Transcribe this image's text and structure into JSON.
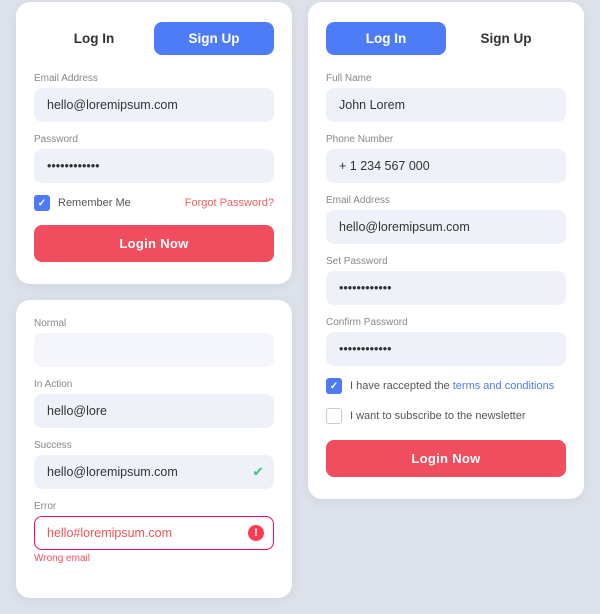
{
  "left_card": {
    "tabs": [
      {
        "label": "Log In",
        "active": false
      },
      {
        "label": "Sign Up",
        "active": true
      }
    ],
    "fields": [
      {
        "label": "Email Address",
        "value": "hello@loremipsum.com",
        "type": "text"
      },
      {
        "label": "Password",
        "value": "············",
        "type": "password"
      }
    ],
    "remember_me": "Remember Me",
    "forgot_password": "Forgot Password?",
    "login_button": "Login Now"
  },
  "states_card": {
    "states": [
      {
        "label": "Normal",
        "value": "",
        "state": "normal"
      },
      {
        "label": "In Action",
        "value": "hello@lore",
        "state": "in-action"
      },
      {
        "label": "Success",
        "value": "hello@loremipsum.com",
        "state": "success"
      },
      {
        "label": "Error",
        "value": "hello#loremipsum.com",
        "state": "error"
      }
    ],
    "error_text": "Wrong email"
  },
  "right_card": {
    "tabs": [
      {
        "label": "Log In",
        "active": true
      },
      {
        "label": "Sign Up",
        "active": false
      }
    ],
    "fields": [
      {
        "label": "Full Name",
        "value": "John Lorem",
        "type": "text"
      },
      {
        "label": "Phone Number",
        "value": "+ 1 234 567 000",
        "type": "text"
      },
      {
        "label": "Email Address",
        "value": "hello@loremipsum.com",
        "type": "text"
      },
      {
        "label": "Set Password",
        "value": "············",
        "type": "password"
      },
      {
        "label": "Confirm Password",
        "value": "············",
        "type": "password"
      }
    ],
    "terms_text": "I have raccepted the ",
    "terms_link": "terms and conditions",
    "newsletter_label": "I want to subscribe to the newsletter",
    "login_button": "Login Now"
  }
}
